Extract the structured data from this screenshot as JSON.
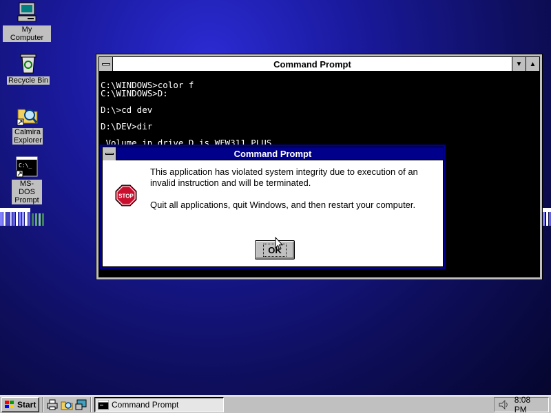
{
  "desktop": {
    "icons": [
      {
        "label": "My Computer"
      },
      {
        "label": "Recycle Bin"
      },
      {
        "label": "Calmira Explorer"
      },
      {
        "label": "MS-DOS Prompt"
      }
    ],
    "msdos_icon_text": "C:\\_"
  },
  "console_window": {
    "title": "Command Prompt",
    "lines": [
      "C:\\WINDOWS>color f",
      "C:\\WINDOWS>D:",
      "",
      "D:\\>cd dev",
      "",
      "D:\\DEV>dir",
      "",
      " Volume in drive D is WFW311_PLUS"
    ]
  },
  "dialog": {
    "title": "Command Prompt",
    "icon": "stop-icon",
    "icon_text": "STOP",
    "message1": "This application has violated system integrity due to execution of an invalid instruction and will be terminated.",
    "message2": "Quit all applications, quit Windows, and then restart your computer.",
    "ok_label": "OK"
  },
  "taskbar": {
    "start_label": "Start",
    "task_label": "Command Prompt",
    "clock": "8:08 PM"
  },
  "colors": {
    "desktop_bg": "#1a1a9e",
    "dialog_title_bg": "#00008a",
    "stop_red": "#c8102e"
  }
}
